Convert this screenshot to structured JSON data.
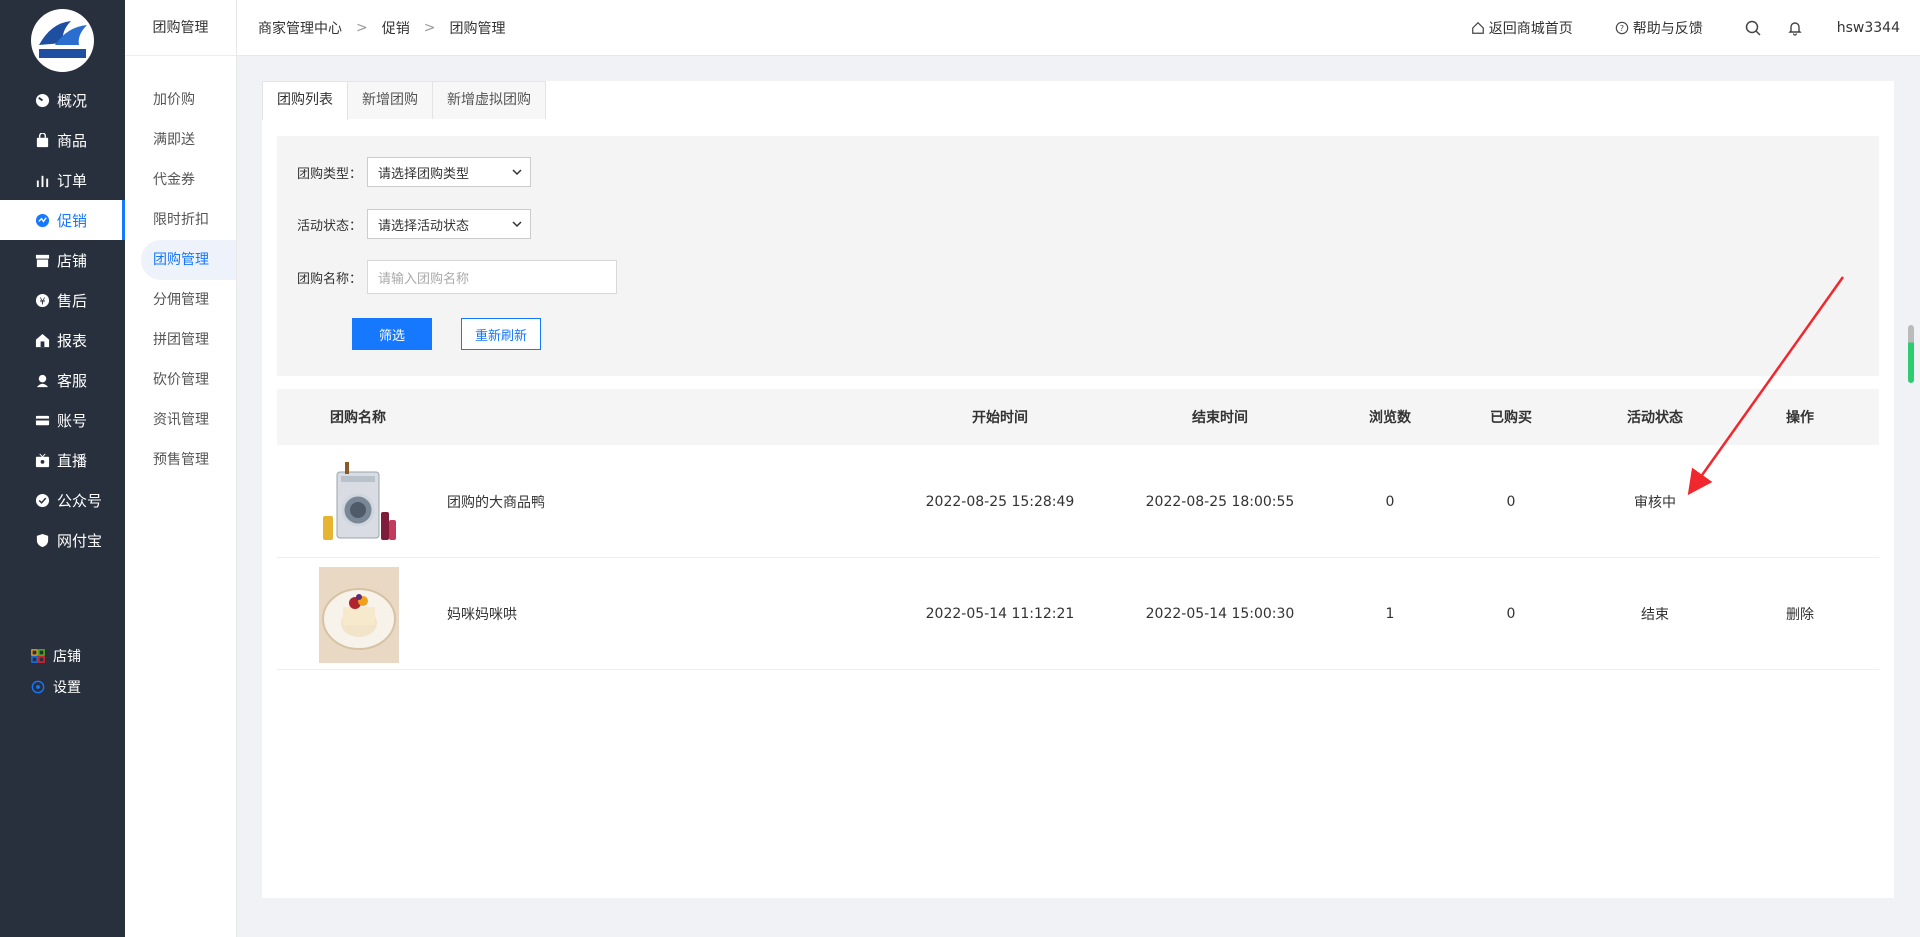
{
  "sidebar": {
    "items": [
      {
        "label": "概况",
        "icon": "dashboard-icon"
      },
      {
        "label": "商品",
        "icon": "bag-icon"
      },
      {
        "label": "订单",
        "icon": "bar-chart-icon"
      },
      {
        "label": "促销",
        "icon": "promo-icon"
      },
      {
        "label": "店铺",
        "icon": "store-icon"
      },
      {
        "label": "售后",
        "icon": "service-icon"
      },
      {
        "label": "报表",
        "icon": "report-icon"
      },
      {
        "label": "客服",
        "icon": "headset-icon"
      },
      {
        "label": "账号",
        "icon": "card-icon"
      },
      {
        "label": "直播",
        "icon": "live-icon"
      },
      {
        "label": "公众号",
        "icon": "check-shield-icon"
      },
      {
        "label": "网付宝",
        "icon": "shield-icon"
      }
    ],
    "bottom": [
      {
        "label": "店铺",
        "icon": "grid-icon"
      },
      {
        "label": "设置",
        "icon": "settings-icon"
      }
    ]
  },
  "subnav": {
    "title": "团购管理",
    "items": [
      "加价购",
      "满即送",
      "代金券",
      "限时折扣",
      "团购管理",
      "分佣管理",
      "拼团管理",
      "砍价管理",
      "资讯管理",
      "预售管理"
    ]
  },
  "header": {
    "crumbs": [
      "商家管理中心",
      "促销",
      "团购管理"
    ],
    "home_link": "返回商城首页",
    "help_link": "帮助与反馈",
    "user": "hsw3344"
  },
  "tabs": [
    "团购列表",
    "新增团购",
    "新增虚拟团购"
  ],
  "filter": {
    "type_label": "团购类型：",
    "type_value": "请选择团购类型",
    "status_label": "活动状态：",
    "status_value": "请选择活动状态",
    "name_label": "团购名称：",
    "name_placeholder": "请输入团购名称",
    "filter_btn": "筛选",
    "reset_btn": "重新刷新"
  },
  "table": {
    "headers": [
      "团购名称",
      "开始时间",
      "结束时间",
      "浏览数",
      "已购买",
      "活动状态",
      "操作"
    ],
    "rows": [
      {
        "name": "团购的大商品鸭",
        "start": "2022-08-25 15:28:49",
        "end": "2022-08-25 18:00:55",
        "views": "0",
        "bought": "0",
        "status": "审核中",
        "op": ""
      },
      {
        "name": "妈咪妈咪哄",
        "start": "2022-05-14 11:12:21",
        "end": "2022-05-14 15:00:30",
        "views": "1",
        "bought": "0",
        "status": "结束",
        "op": "删除"
      }
    ]
  },
  "colors": {
    "accent": "#1677ff",
    "sidebar": "#28303d",
    "danger": "#f5222d"
  }
}
